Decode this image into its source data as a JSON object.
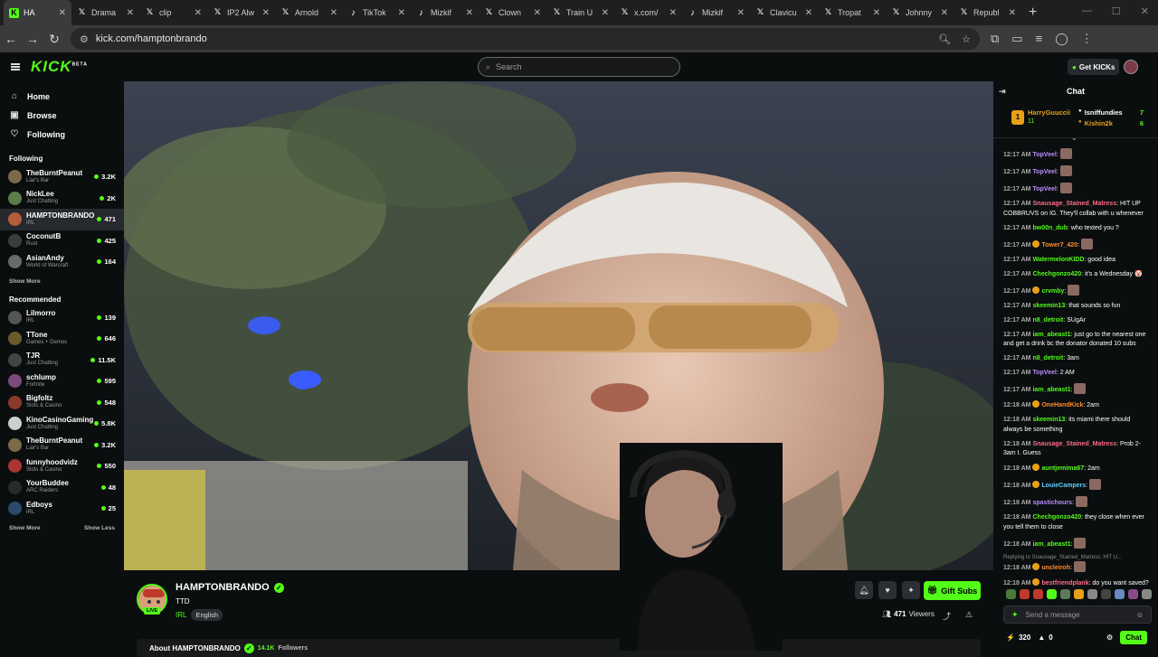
{
  "browser": {
    "tabs": [
      {
        "label": "HA",
        "icon": "kick",
        "active": true
      },
      {
        "label": "Drama",
        "icon": "x"
      },
      {
        "label": "clip",
        "icon": "x"
      },
      {
        "label": "IP2 Alw",
        "icon": "x"
      },
      {
        "label": "Arnold",
        "icon": "x"
      },
      {
        "label": "TikTok",
        "icon": "tiktok"
      },
      {
        "label": "Mizkif",
        "icon": "tiktok"
      },
      {
        "label": "Clown",
        "icon": "x"
      },
      {
        "label": "Train U",
        "icon": "x"
      },
      {
        "label": "x.com/",
        "icon": "x"
      },
      {
        "label": "Mizkif",
        "icon": "tiktok"
      },
      {
        "label": "Clavicu",
        "icon": "x"
      },
      {
        "label": "Tropat",
        "icon": "x"
      },
      {
        "label": "Johnny",
        "icon": "x"
      },
      {
        "label": "Republ",
        "icon": "x"
      }
    ],
    "url": "kick.com/hamptonbrando"
  },
  "header": {
    "logo": "KICK",
    "logo_sup": "BETA",
    "search_placeholder": "Search",
    "get_kicks": "Get KICKs"
  },
  "sidebar": {
    "nav": [
      {
        "label": "Home",
        "icon": "home-icon",
        "glyph": "⌂"
      },
      {
        "label": "Browse",
        "icon": "browse-icon",
        "glyph": "▣"
      },
      {
        "label": "Following",
        "icon": "heart-icon",
        "glyph": "♡"
      }
    ],
    "following_title": "Following",
    "following": [
      {
        "name": "TheBurntPeanut",
        "category": "Liar's Bar",
        "viewers": "3.2K",
        "color": "#7b6a4a"
      },
      {
        "name": "NickLee",
        "category": "Just Chatting",
        "viewers": "2K",
        "color": "#5c7d4a"
      },
      {
        "name": "HAMPTONBRANDO",
        "category": "IRL",
        "viewers": "471",
        "color": "#b45c3c",
        "selected": true
      },
      {
        "name": "CoconutB",
        "category": "Rust",
        "viewers": "425",
        "color": "#3c3c3c"
      },
      {
        "name": "AsianAndy",
        "category": "World of Warcraft",
        "viewers": "164",
        "color": "#6a6a6a"
      }
    ],
    "show_more": "Show More",
    "recommended_title": "Recommended",
    "recommended": [
      {
        "name": "Lilmorro",
        "category": "IRL",
        "viewers": "139",
        "color": "#555"
      },
      {
        "name": "TTone",
        "category": "Games + Demos",
        "viewers": "646",
        "color": "#6b5a2a"
      },
      {
        "name": "TJR",
        "category": "Just Chatting",
        "viewers": "11.5K",
        "color": "#444"
      },
      {
        "name": "schlump",
        "category": "Fortnite",
        "viewers": "595",
        "color": "#7a4a7a"
      },
      {
        "name": "Bigfoltz",
        "category": "Slots & Casino",
        "viewers": "548",
        "color": "#8a3a2a"
      },
      {
        "name": "KinoCasinoGaming",
        "category": "Just Chatting",
        "viewers": "5.8K",
        "color": "#cfcfcf"
      },
      {
        "name": "TheBurntPeanut",
        "category": "Liar's Bar",
        "viewers": "3.2K",
        "color": "#7b6a4a"
      },
      {
        "name": "funnyhoodvidz",
        "category": "Slots & Casino",
        "viewers": "550",
        "color": "#a33"
      },
      {
        "name": "YourBuddee",
        "category": "ARC Raiders",
        "viewers": "48",
        "color": "#2a2a2a"
      },
      {
        "name": "Edboys",
        "category": "IRL",
        "viewers": "25",
        "color": "#2a4a6a"
      }
    ],
    "show_more_2": "Show More",
    "show_less": "Show Less"
  },
  "stream": {
    "name": "HAMPTONBRANDO",
    "title": "TTD",
    "category": "IRL",
    "language": "English",
    "live": "LIVE",
    "gift_subs": "Gift Subs",
    "viewers": "471",
    "viewers_label": "Viewers",
    "about": "About HAMPTONBRANDO",
    "followers": "14.1K",
    "followers_label": "Followers"
  },
  "chat": {
    "title": "Chat",
    "leaderboard": {
      "first": {
        "rank": "1",
        "name": "HarryGuuccii",
        "count": "11"
      },
      "rows": [
        {
          "name": "Isniffundies",
          "count": "7",
          "color": "#ffffff"
        },
        {
          "name": "Kishin2k",
          "count": "6",
          "color": "#e8a117"
        }
      ]
    },
    "messages": [
      {
        "time": "12:17 AM",
        "user": "TopVeel",
        "color": "#b98cff",
        "text": "",
        "emote": true
      },
      {
        "time": "12:17 AM",
        "user": "TopVeel",
        "color": "#b98cff",
        "text": "",
        "emote": true
      },
      {
        "time": "12:17 AM",
        "user": "TopVeel",
        "color": "#b98cff",
        "text": "",
        "emote": true
      },
      {
        "time": "12:17 AM",
        "user": "Snausage_Stained_Matress",
        "color": "#ff6b8a",
        "text": "HIT UP COBBRUVS on IG. They'll collab with u whenever"
      },
      {
        "time": "12:17 AM",
        "user": "bw00n_dub",
        "color": "#53fc18",
        "text": "who texted you ?"
      },
      {
        "time": "12:17 AM",
        "user": "Tower7_420",
        "color": "#ff8c2a",
        "text": "",
        "emote": true,
        "badge": true
      },
      {
        "time": "12:17 AM",
        "user": "WatermelonKIDD",
        "color": "#53fc18",
        "text": "good idea"
      },
      {
        "time": "12:17 AM",
        "user": "Chechgonzo420",
        "color": "#53fc18",
        "text": "it's a Wednesday 🤡"
      },
      {
        "time": "12:17 AM",
        "user": "crvmby",
        "color": "#53fc18",
        "text": "",
        "emote": true,
        "badge": true
      },
      {
        "time": "12:17 AM",
        "user": "skeemin13",
        "color": "#53fc18",
        "text": "that sounds so fun"
      },
      {
        "time": "12:17 AM",
        "user": "n8_detroit",
        "color": "#53fc18",
        "text": "SUgAr"
      },
      {
        "time": "12:17 AM",
        "user": "iam_abeast1",
        "color": "#53fc18",
        "text": "just go to the nearest one and get a drink bc the donator donated 10 subs"
      },
      {
        "time": "12:17 AM",
        "user": "n8_detroit",
        "color": "#53fc18",
        "text": "3am"
      },
      {
        "time": "12:17 AM",
        "user": "TopVeel",
        "color": "#b98cff",
        "text": "2 AM"
      },
      {
        "time": "12:17 AM",
        "user": "iam_abeast1",
        "color": "#53fc18",
        "text": "",
        "emote": true
      },
      {
        "time": "12:18 AM",
        "user": "OneHandKick",
        "color": "#ff8c2a",
        "text": "2am",
        "badge": true
      },
      {
        "time": "12:18 AM",
        "user": "skeemin13",
        "color": "#53fc18",
        "text": "its miami there should always be something"
      },
      {
        "time": "12:18 AM",
        "user": "Snausage_Stained_Matress",
        "color": "#ff6b8a",
        "text": "Prob 2-3am I. Guess"
      },
      {
        "time": "12:18 AM",
        "user": "auntjemima67",
        "color": "#53fc18",
        "text": "2am",
        "badge": true
      },
      {
        "time": "12:18 AM",
        "user": "LouieCampers",
        "color": "#5ad1ff",
        "text": "",
        "emote": true,
        "badge": true
      },
      {
        "time": "12:18 AM",
        "user": "spastichours",
        "color": "#b98cff",
        "text": "",
        "emote": true
      },
      {
        "time": "12:18 AM",
        "user": "Chechgonzo420",
        "color": "#53fc18",
        "text": "they close when ever you tell them to close"
      },
      {
        "time": "12:18 AM",
        "user": "iam_abeast1",
        "color": "#53fc18",
        "text": "",
        "emote": true
      },
      {
        "time": "12:18 AM",
        "user": "uncleiroh",
        "color": "#ff8c2a",
        "text": "",
        "emote": true,
        "badge": true,
        "reply": "Replying to Snausage_Stained_Matress: HIT U..."
      },
      {
        "time": "12:18 AM",
        "user": "bestfriendplank",
        "color": "#ff6b8a",
        "text": "do you want saved?",
        "badge": true
      }
    ],
    "input_placeholder": "Send a message",
    "kicks": "320",
    "count2": "0",
    "chat_button": "Chat"
  }
}
